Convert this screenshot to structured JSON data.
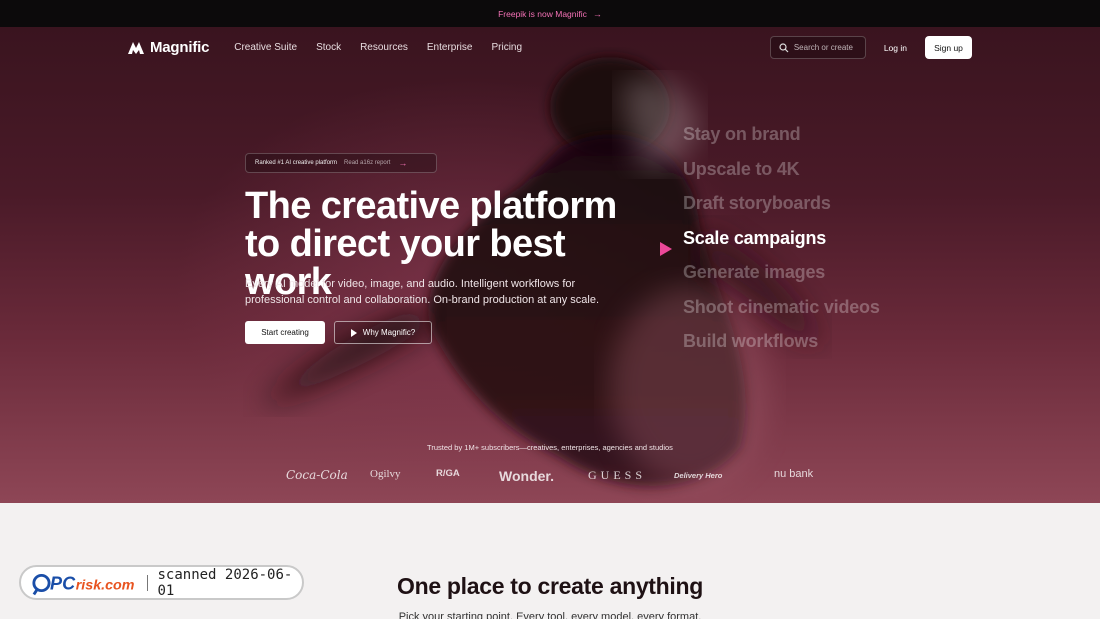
{
  "announcement": {
    "text": "Freepik is now Magnific",
    "arrow": "→"
  },
  "nav": {
    "brand": "Magnific",
    "links": [
      "Creative Suite",
      "Stock",
      "Resources",
      "Enterprise",
      "Pricing"
    ],
    "search_placeholder": "Search or create",
    "login": "Log in",
    "signup": "Sign up"
  },
  "hero": {
    "badge": {
      "label": "Ranked #1 AI creative platform",
      "link": "Read a16z report",
      "arrow": "→"
    },
    "headline": "The creative platform to direct your best work",
    "subtext": "Every AI model for video, image, and audio. Intelligent workflows for professional control and collaboration. On-brand production at any scale.",
    "cta_primary": "Start creating",
    "cta_secondary": "Why Magnific?",
    "rotating_words": [
      "Stay on brand",
      "Upscale to 4K",
      "Draft storyboards",
      "Scale campaigns",
      "Generate images",
      "Shoot cinematic videos",
      "Build workflows"
    ],
    "active_word_index": 3,
    "trusted_text": "Trusted by 1M+ subscribers—creatives, enterprises, agencies and studios",
    "client_logos": [
      "Coca-Cola",
      "Ogilvy",
      "R/GA",
      "Wonder.",
      "GUESS",
      "Delivery Hero",
      "nu bank"
    ]
  },
  "section": {
    "title": "One place to create anything",
    "subtitle": "Pick your starting point. Every tool, every model, every format."
  },
  "watermark": {
    "brand": "PCrisk.com",
    "text": "scanned 2026-06-01"
  },
  "colors": {
    "accent": "#ec4899",
    "link": "#f472b6",
    "hero_bg": "#4a1a28",
    "page_bg": "#f3f1f1"
  }
}
